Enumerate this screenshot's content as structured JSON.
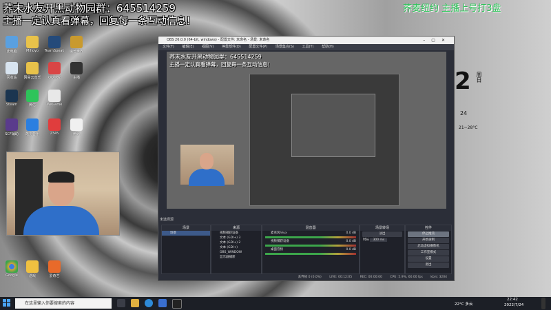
{
  "overlay": {
    "line1": "荞末水友开黑动物园群：645514259",
    "line2": "主播一定认真看弹幕，回复每一条互动信息！",
    "right": "荞麦纽约  主播上号打3盘"
  },
  "desktop_icons": [
    {
      "label": "此电脑"
    },
    {
      "label": "Mihoyo"
    },
    {
      "label": "TeamSpeak"
    },
    {
      "label": "魔兽世界"
    },
    {
      "label": "回收站"
    },
    {
      "label": "网易云音乐"
    },
    {
      "label": "QQ游戏"
    },
    {
      "label": "主播"
    },
    {
      "label": "Steam"
    },
    {
      "label": "微信"
    },
    {
      "label": "WeGame"
    },
    {
      "label": "SCF辅助"
    },
    {
      "label": "酷狗音乐"
    },
    {
      "label": "2345"
    },
    {
      "label": "腾讯"
    },
    {
      "label": "Google"
    },
    {
      "label": "游戏"
    },
    {
      "label": "爱奇艺"
    }
  ],
  "obs": {
    "title": "OBS 26.0.0 (64-bit, windows) - 配置文件: 未命名 - 场景: 未命名",
    "menu": [
      "文件(F)",
      "编辑(E)",
      "视图(V)",
      "停靠部件(D)",
      "配置文件(P)",
      "场景集合(S)",
      "工具(T)",
      "帮助(H)"
    ],
    "preview_line1": "荞末水友开黑动物园群：645514259",
    "preview_line2": "主播一定认真看弹幕，回复每一条互动信息！",
    "notice": "未选择源",
    "docks": {
      "scenes": {
        "title": "场景",
        "items": [
          "场景"
        ]
      },
      "sources": {
        "title": "来源",
        "items": [
          "视频捕获设备",
          "文本 (GDI+) 3",
          "文本 (GDI+) 2",
          "文本 (GDI+)",
          "OBS_WINDOW",
          "显示器捕获"
        ]
      },
      "mixer": {
        "title": "混音器",
        "channels": [
          {
            "name": "麦克风/Aux",
            "db": "0.0 dB"
          },
          {
            "name": "视频捕获设备",
            "db": "0.0 dB"
          },
          {
            "name": "桌面音频",
            "db": "0.0 dB"
          }
        ]
      },
      "transitions": {
        "title": "场景转场",
        "type": "淡出",
        "duration_label": "时长",
        "duration": "300 ms"
      },
      "controls": {
        "title": "控件",
        "buttons": [
          "停止推流",
          "开始录制",
          "启动虚拟摄像机",
          "工作室模式",
          "设置",
          "退出"
        ]
      }
    },
    "status": {
      "dropped": "丢弃帧 0 (0.0%)",
      "live": "LIVE: 00:12:05",
      "rec": "REC: 00:00:00",
      "cpu": "CPU: 5.9%, 60.00 fps",
      "kbps": "kb/s: 3204"
    }
  },
  "wallpaper_text": {
    "big": "2",
    "weekday": "周日",
    "temp": "21~28°C",
    "day": "24"
  },
  "taskbar": {
    "search_placeholder": "在这里输入你要搜索的内容",
    "weather": "22°C 多云",
    "time": "22:42",
    "date": "2022/7/24"
  }
}
